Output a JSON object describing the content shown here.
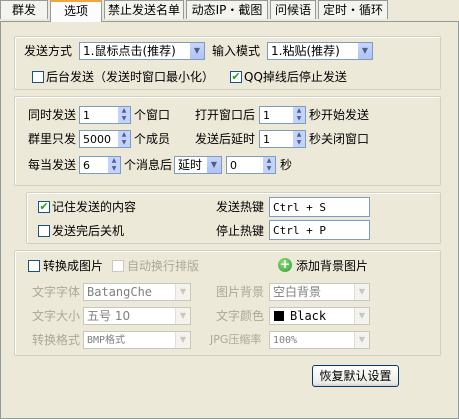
{
  "tabs": [
    "群发",
    "选项",
    "禁止发送名单",
    "动态IP・截图",
    "问候语",
    "定时・循环"
  ],
  "send": {
    "mode_label": "发送方式",
    "mode_value": "1.鼠标点击(推荐)",
    "input_label": "输入模式",
    "input_value": "1.粘贴(推荐)",
    "background_label": "后台发送（发送时窗口最小化）",
    "background_checked": false,
    "stop_label": "QQ掉线后停止发送",
    "stop_checked": true
  },
  "timing": {
    "concurrent_label": "同时发送",
    "concurrent_value": "1",
    "concurrent_unit": "个窗口",
    "open_label": "打开窗口后",
    "open_value": "1",
    "open_unit": "秒开始发送",
    "group_label": "群里只发",
    "group_value": "5000",
    "group_unit": "个成员",
    "delay_label": "发送后延时",
    "delay_value": "1",
    "delay_unit": "秒关闭窗口",
    "every_label": "每当发送",
    "every_value": "6",
    "every_unit": "个消息后",
    "pause_mode": "延时",
    "pause_value": "0",
    "pause_unit": "秒"
  },
  "hotkeys": {
    "remember_label": "记住发送的内容",
    "remember_checked": true,
    "shutdown_label": "发送完后关机",
    "shutdown_checked": false,
    "send_label": "发送热键",
    "send_value": "Ctrl + S",
    "stop_label": "停止热键",
    "stop_value": "Ctrl + P"
  },
  "image": {
    "convert_label": "转换成图片",
    "convert_checked": false,
    "wrap_label": "自动换行排版",
    "wrap_checked": false,
    "add_bg_label": "添加背景图片",
    "font_label": "文字字体",
    "font_value": "BatangChe",
    "bg_label": "图片背景",
    "bg_value": "空白背景",
    "size_label": "文字大小",
    "size_value": "五号 10",
    "color_label": "文字颜色",
    "color_value": "Black",
    "format_label": "转换格式",
    "format_value": "BMP格式",
    "jpg_label": "JPG压缩率",
    "jpg_value": "100%"
  },
  "restore_label": "恢复默认设置",
  "colors": {
    "swatch": "#000000",
    "check": "#21a121"
  }
}
